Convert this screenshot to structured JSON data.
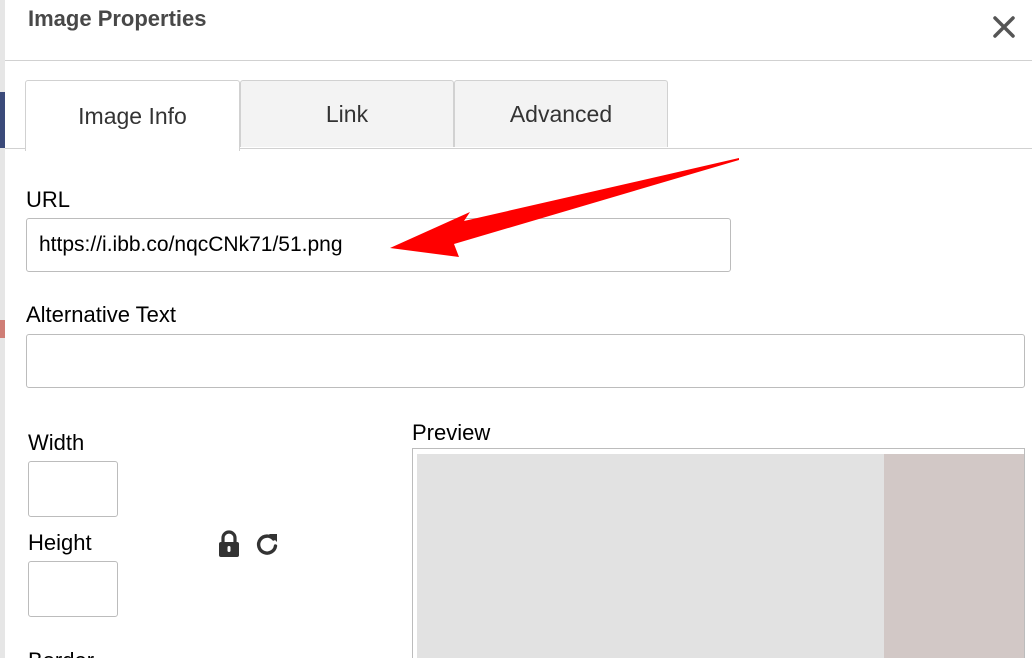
{
  "dialog": {
    "title": "Image Properties"
  },
  "tabs": [
    {
      "label": "Image Info"
    },
    {
      "label": "Link"
    },
    {
      "label": "Advanced"
    }
  ],
  "fields": {
    "url": {
      "label": "URL",
      "value": "https://i.ibb.co/nqcCNk71/51.png"
    },
    "alt_text": {
      "label": "Alternative Text",
      "value": ""
    },
    "width": {
      "label": "Width",
      "value": ""
    },
    "height": {
      "label": "Height",
      "value": ""
    },
    "border": {
      "label": "Border"
    }
  },
  "preview": {
    "label": "Preview"
  },
  "icons": {
    "close": "close-icon",
    "lock": "lock-icon",
    "reset": "reset-size-icon"
  },
  "colors": {
    "annotation_arrow": "#ff0000",
    "title_text": "#484848",
    "active_tab": "#ffffff",
    "inactive_tab": "#f3f3f3"
  }
}
